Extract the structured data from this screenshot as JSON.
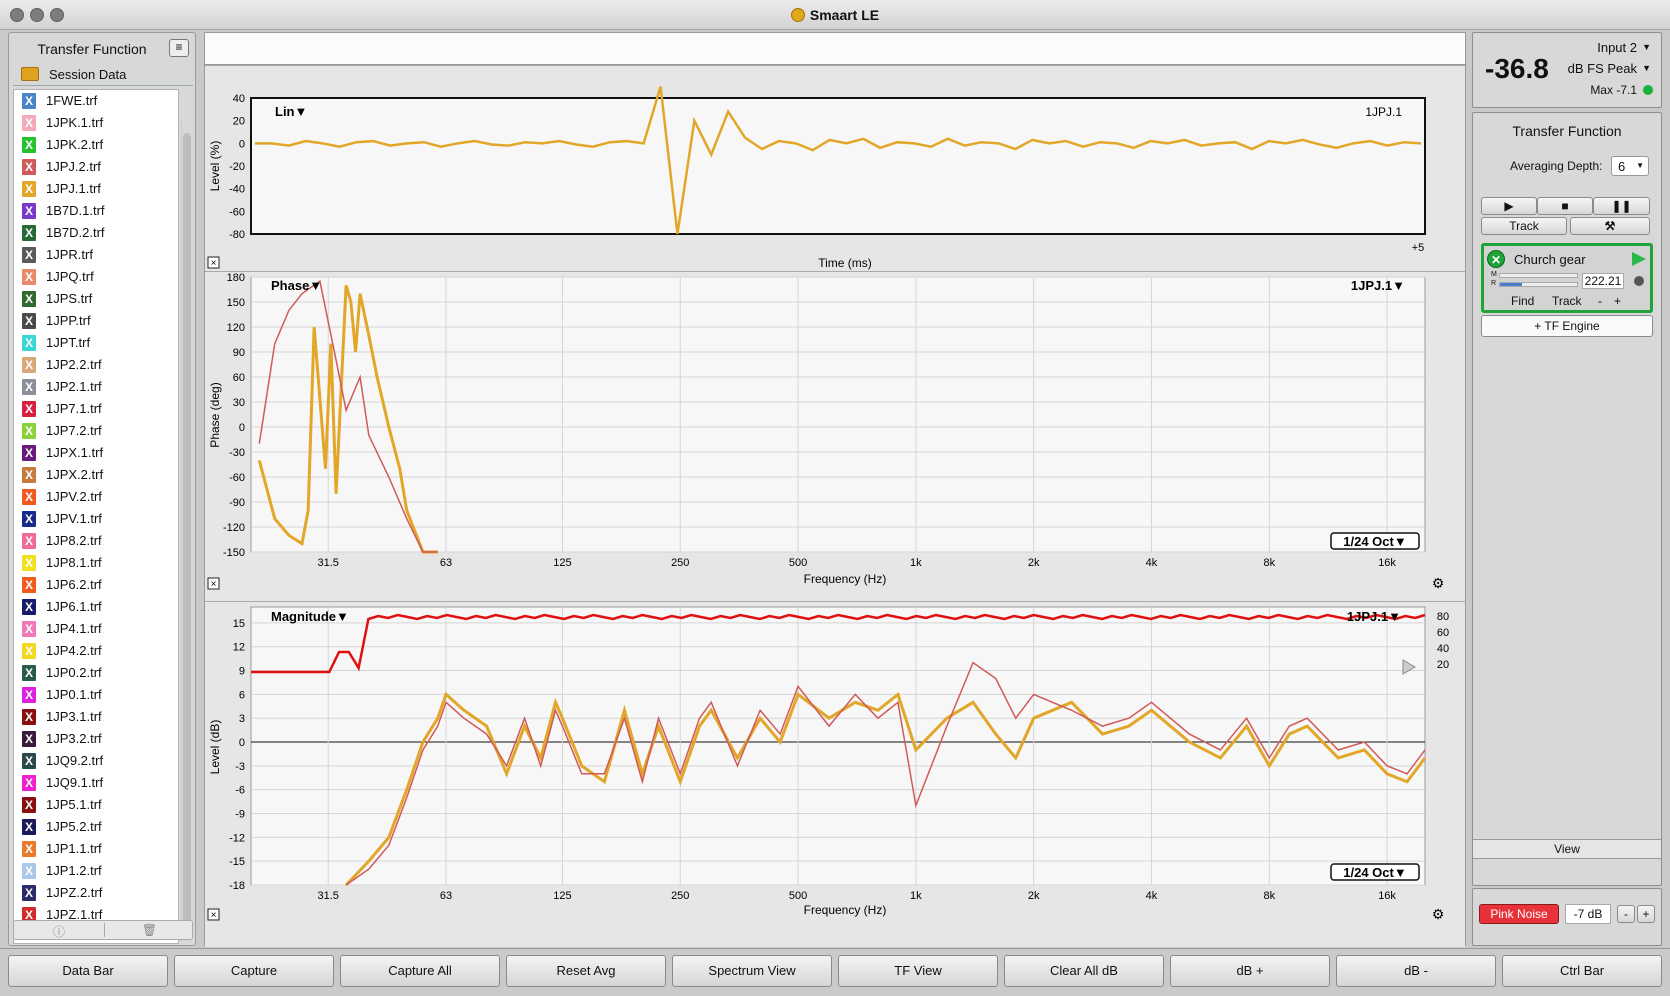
{
  "app": {
    "title": "Smaart LE"
  },
  "sidebar": {
    "title": "Transfer Function",
    "session_label": "Session Data",
    "files": [
      {
        "name": "1FWE.trf",
        "color": "#4c84c8"
      },
      {
        "name": "1JPK.1.trf",
        "color": "#f2a9b8"
      },
      {
        "name": "1JPK.2.trf",
        "color": "#23c12e"
      },
      {
        "name": "1JPJ.2.trf",
        "color": "#d05a5a"
      },
      {
        "name": "1JPJ.1.trf",
        "color": "#e2a628"
      },
      {
        "name": "1B7D.1.trf",
        "color": "#7a38c9"
      },
      {
        "name": "1B7D.2.trf",
        "color": "#276a36"
      },
      {
        "name": "1JPR.trf",
        "color": "#5a5a5a"
      },
      {
        "name": "1JPQ.trf",
        "color": "#e88a6a"
      },
      {
        "name": "1JPS.trf",
        "color": "#2f6a2f"
      },
      {
        "name": "1JPP.trf",
        "color": "#4a4a4a"
      },
      {
        "name": "1JPT.trf",
        "color": "#38d6d6"
      },
      {
        "name": "1JP2.2.trf",
        "color": "#d8a878"
      },
      {
        "name": "1JP2.1.trf",
        "color": "#8a8f9a"
      },
      {
        "name": "1JP7.1.trf",
        "color": "#d82040"
      },
      {
        "name": "1JP7.2.trf",
        "color": "#8ad23a"
      },
      {
        "name": "1JPX.1.trf",
        "color": "#6a1a7a"
      },
      {
        "name": "1JPX.2.trf",
        "color": "#c87a3a"
      },
      {
        "name": "1JPV.2.trf",
        "color": "#f05a20"
      },
      {
        "name": "1JPV.1.trf",
        "color": "#1a2a8a"
      },
      {
        "name": "1JP8.2.trf",
        "color": "#f06a9a"
      },
      {
        "name": "1JP8.1.trf",
        "color": "#f2e020"
      },
      {
        "name": "1JP6.2.trf",
        "color": "#f05a1a"
      },
      {
        "name": "1JP6.1.trf",
        "color": "#1a1a6a"
      },
      {
        "name": "1JP4.1.trf",
        "color": "#f07ab8"
      },
      {
        "name": "1JP4.2.trf",
        "color": "#f2d820"
      },
      {
        "name": "1JP0.2.trf",
        "color": "#2a5a4a"
      },
      {
        "name": "1JP0.1.trf",
        "color": "#e020e0"
      },
      {
        "name": "1JP3.1.trf",
        "color": "#8a1010"
      },
      {
        "name": "1JP3.2.trf",
        "color": "#3a1a3a"
      },
      {
        "name": "1JQ9.2.trf",
        "color": "#2a4a4a"
      },
      {
        "name": "1JQ9.1.trf",
        "color": "#f020d0"
      },
      {
        "name": "1JP5.1.trf",
        "color": "#8a1010"
      },
      {
        "name": "1JP5.2.trf",
        "color": "#1a1a5a"
      },
      {
        "name": "1JP1.1.trf",
        "color": "#e87a2a"
      },
      {
        "name": "1JP1.2.trf",
        "color": "#a8c8e8"
      },
      {
        "name": "1JPZ.2.trf",
        "color": "#2a2a6a"
      },
      {
        "name": "1JPZ.1.trf",
        "color": "#d02a2a"
      }
    ]
  },
  "impulse": {
    "mode": "Lin▼",
    "trace_label": "1JPJ.1",
    "ylabel": "Level (%)",
    "xlabel": "Time (ms)",
    "x_tick": "+5",
    "yticks": [
      "40",
      "20",
      "0",
      "-20",
      "-40",
      "-60",
      "-80"
    ]
  },
  "phase": {
    "mode": "Phase▼",
    "trace_label": "1JPJ.1▼",
    "ylabel": "Phase (deg)",
    "xlabel": "Frequency (Hz)",
    "smoothing": "1/24 Oct▼",
    "yticks": [
      "180",
      "150",
      "120",
      "90",
      "60",
      "30",
      "0",
      "-30",
      "-60",
      "-90",
      "-120",
      "-150"
    ],
    "xticks": [
      "31.5",
      "63",
      "125",
      "250",
      "500",
      "1k",
      "2k",
      "4k",
      "8k",
      "16k"
    ]
  },
  "magnitude": {
    "mode": "Magnitude▼",
    "trace_label": "1JPJ.1▼",
    "ylabel": "Level (dB)",
    "xlabel": "Frequency (Hz)",
    "smoothing": "1/24 Oct▼",
    "yticks": [
      "15",
      "12",
      "9",
      "6",
      "3",
      "0",
      "-3",
      "-6",
      "-9",
      "-12",
      "-15",
      "-18"
    ],
    "coh_ticks": [
      "80",
      "60",
      "40",
      "20"
    ],
    "xticks": [
      "31.5",
      "63",
      "125",
      "250",
      "500",
      "1k",
      "2k",
      "4k",
      "8k",
      "16k"
    ]
  },
  "chart_data": [
    {
      "type": "line",
      "title": "",
      "xlabel": "Time (ms)",
      "ylabel": "Level (%)",
      "ylim": [
        -80,
        40
      ],
      "series": [
        {
          "values": [
            0,
            0,
            -2,
            2,
            0,
            -3,
            1,
            2,
            -2,
            0,
            1,
            -3,
            0,
            2,
            -1,
            -2,
            1,
            0,
            2,
            -1,
            -3,
            1,
            2,
            0,
            50,
            -80,
            20,
            -10,
            28,
            5,
            -5,
            2,
            0,
            -6,
            3,
            0,
            4,
            -4,
            1,
            0,
            -3,
            4,
            -2,
            1,
            0,
            -5,
            3,
            0,
            2,
            -3,
            1,
            0,
            -4,
            2,
            0,
            3,
            -2,
            0,
            1,
            -5,
            2,
            0,
            3,
            -1,
            -4,
            0,
            2,
            -2,
            1,
            0
          ]
        }
      ]
    },
    {
      "type": "line",
      "title": "",
      "xlabel": "Frequency (Hz)",
      "ylabel": "Phase (deg)",
      "ylim": [
        -150,
        180
      ],
      "xscale": "log",
      "series": [
        {
          "color": "#e2a628",
          "x": [
            21,
            23,
            25,
            27,
            28,
            29,
            31,
            32,
            33,
            35,
            36,
            37,
            38,
            40,
            42,
            45,
            48,
            50,
            55,
            60
          ],
          "values": [
            -40,
            -110,
            -130,
            -140,
            -100,
            120,
            -50,
            100,
            -80,
            170,
            150,
            90,
            160,
            110,
            60,
            0,
            -50,
            -100,
            -150,
            -150
          ]
        },
        {
          "color": "#d05a5a",
          "x": [
            21,
            23,
            25,
            27,
            30,
            33,
            35,
            38,
            40,
            45,
            50,
            55,
            60
          ],
          "values": [
            -20,
            100,
            140,
            160,
            175,
            80,
            20,
            60,
            -10,
            -60,
            -110,
            -150,
            -150
          ]
        }
      ]
    },
    {
      "type": "line",
      "title": "",
      "xlabel": "Frequency (Hz)",
      "ylabel": "Level (dB)",
      "ylim": [
        -18,
        15
      ],
      "xscale": "log",
      "series": [
        {
          "color": "#e2a628",
          "x": [
            35,
            40,
            45,
            50,
            55,
            60,
            63,
            70,
            80,
            90,
            100,
            110,
            120,
            125,
            140,
            160,
            180,
            200,
            220,
            250,
            280,
            300,
            350,
            400,
            450,
            500,
            600,
            700,
            800,
            900,
            1000,
            1200,
            1400,
            1600,
            1800,
            2000,
            2500,
            3000,
            3500,
            4000,
            5000,
            6000,
            7000,
            8000,
            9000,
            10000,
            12000,
            14000,
            16000,
            18000,
            20000
          ],
          "values": [
            -18,
            -15,
            -12,
            -6,
            0,
            3,
            6,
            4,
            2,
            -4,
            2,
            -2,
            5,
            3,
            -3,
            -5,
            4,
            -4,
            2,
            -5,
            2,
            4,
            -2,
            3,
            0,
            6,
            3,
            5,
            4,
            6,
            -1,
            3,
            5,
            1,
            -2,
            3,
            5,
            1,
            2,
            4,
            0,
            -2,
            2,
            -3,
            1,
            2,
            -2,
            -1,
            -4,
            -5,
            -2
          ]
        },
        {
          "color": "#d05a5a",
          "x": [
            35,
            40,
            45,
            50,
            55,
            60,
            63,
            70,
            80,
            90,
            100,
            110,
            120,
            125,
            140,
            160,
            180,
            200,
            220,
            250,
            280,
            300,
            350,
            400,
            450,
            500,
            600,
            700,
            800,
            900,
            1000,
            1200,
            1400,
            1600,
            1800,
            2000,
            2500,
            3000,
            3500,
            4000,
            5000,
            6000,
            7000,
            8000,
            9000,
            10000,
            12000,
            14000,
            16000,
            18000,
            20000
          ],
          "values": [
            -18,
            -16,
            -13,
            -7,
            -1,
            2,
            5,
            3,
            1,
            -3,
            3,
            -3,
            4,
            2,
            -4,
            -4,
            3,
            -5,
            3,
            -4,
            3,
            5,
            -3,
            4,
            1,
            7,
            2,
            6,
            3,
            5,
            -8,
            2,
            10,
            8,
            3,
            6,
            4,
            2,
            3,
            5,
            1,
            -1,
            3,
            -2,
            2,
            3,
            -1,
            0,
            -3,
            -4,
            -1
          ]
        }
      ]
    }
  ],
  "right_panel": {
    "level_value": "-36.8",
    "input_label": "Input 2",
    "meter_type": "dB FS Peak",
    "max_label": "Max -7.1",
    "section_title": "Transfer Function",
    "avg_label": "Averaging Depth:",
    "avg_value": "6",
    "play_icon": "▶",
    "stop_icon": "■",
    "pause_icon": "❚❚",
    "track_label": "Track",
    "tools_icon": "⚒",
    "engine": {
      "name": "Church gear",
      "delay": "222.21",
      "m_label": "M",
      "r_label": "R",
      "find": "Find",
      "track": "Track",
      "minus": "-",
      "plus": "+"
    },
    "add_engine": "+ TF Engine",
    "view_label": "View",
    "pink_noise": "Pink Noise",
    "gen_level": "-7 dB",
    "gen_minus": "-",
    "gen_plus": "+"
  },
  "bottom_bar": [
    "Data Bar",
    "Capture",
    "Capture All",
    "Reset Avg",
    "Spectrum View",
    "TF View",
    "Clear All dB",
    "dB +",
    "dB -",
    "Ctrl Bar"
  ]
}
